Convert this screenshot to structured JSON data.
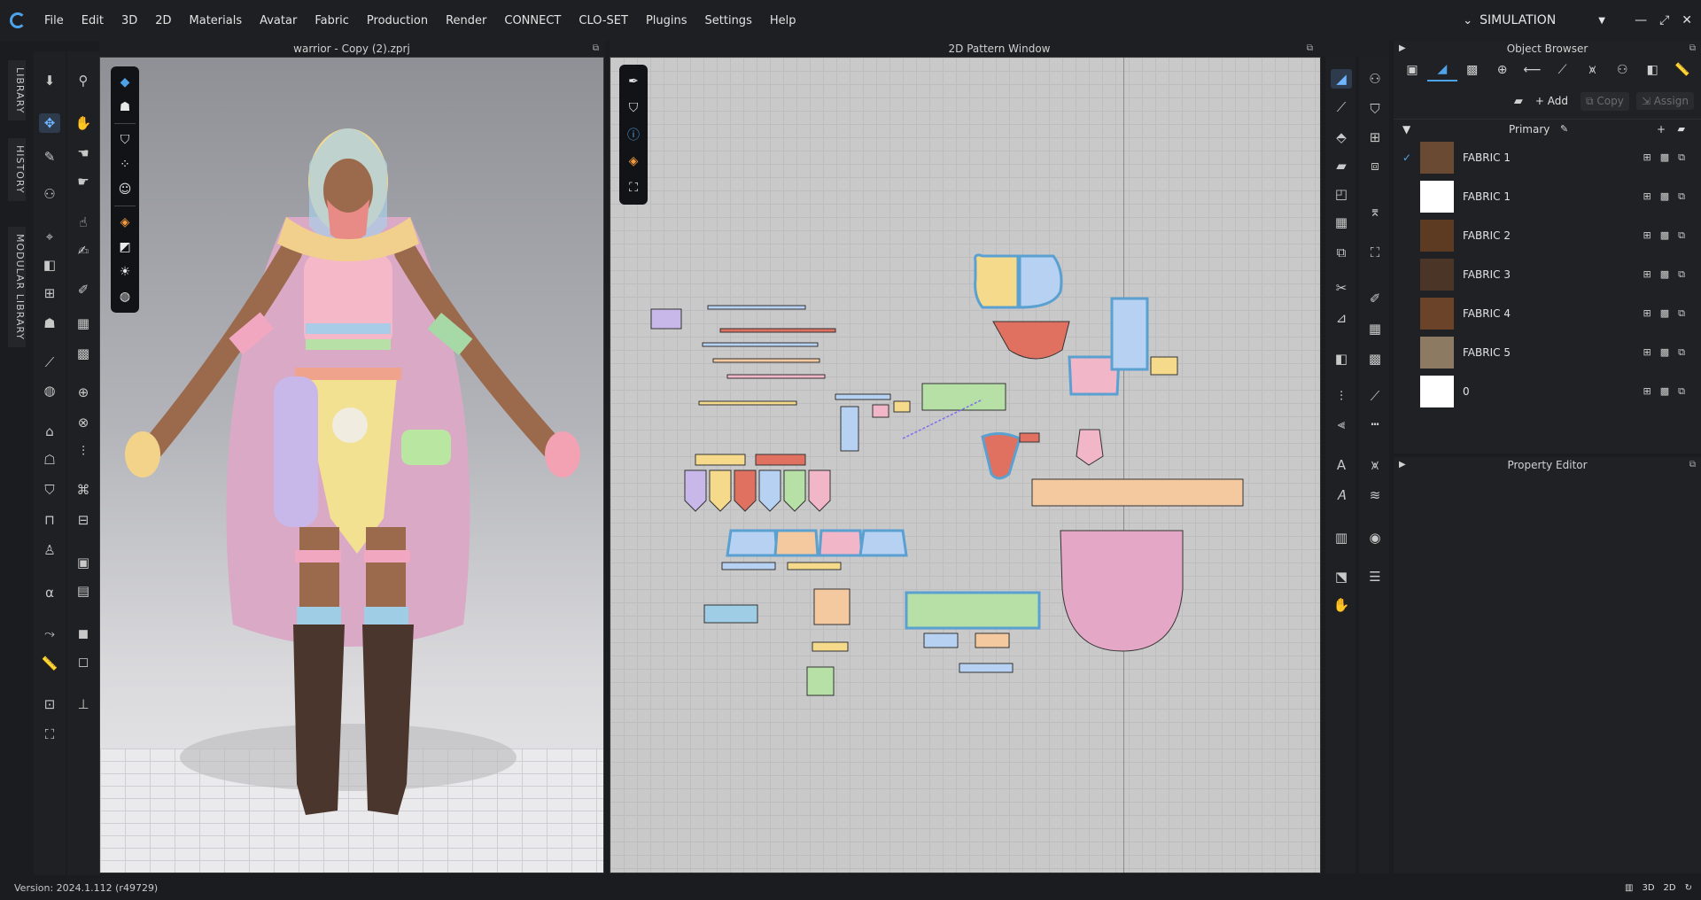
{
  "menu": {
    "items": [
      "File",
      "Edit",
      "3D",
      "2D",
      "Materials",
      "Avatar",
      "Fabric",
      "Production",
      "Render",
      "CONNECT",
      "CLO-SET",
      "Plugins",
      "Settings",
      "Help"
    ],
    "mode": "SIMULATION"
  },
  "side_tabs": [
    "LIBRARY",
    "HISTORY",
    "MODULAR LIBRARY"
  ],
  "viewport3d": {
    "title": "warrior - Copy (2).zprj"
  },
  "pattern2d": {
    "title": "2D Pattern Window"
  },
  "object_browser": {
    "title": "Object Browser",
    "add_label": "Add",
    "copy_label": "Copy",
    "assign_label": "Assign",
    "group_title": "Primary",
    "fabrics": [
      {
        "name": "FABRIC 1",
        "checked": true,
        "swatch": "#6b4a33"
      },
      {
        "name": "FABRIC 1",
        "checked": false,
        "swatch": "#ffffff"
      },
      {
        "name": "FABRIC 2",
        "checked": false,
        "swatch": "#5c3b22"
      },
      {
        "name": "FABRIC 3",
        "checked": false,
        "swatch": "#4a3526"
      },
      {
        "name": "FABRIC 4",
        "checked": false,
        "swatch": "#6b4328"
      },
      {
        "name": "FABRIC 5",
        "checked": false,
        "swatch": "#8d7a63"
      },
      {
        "name": "0",
        "checked": false,
        "swatch": "#ffffff"
      }
    ]
  },
  "property_editor": {
    "title": "Property Editor"
  },
  "status": {
    "version": "Version: 2024.1.112 (r49729)",
    "view_3d": "3D",
    "view_2d": "2D"
  },
  "colors": {
    "accent": "#4ea3e8",
    "panel": "#202124",
    "background": "#1b1c1f"
  }
}
